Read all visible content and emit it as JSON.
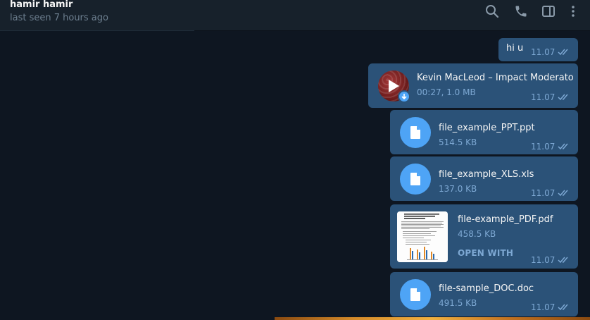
{
  "header": {
    "peer_name": "hamir hamir",
    "status": "last seen 7 hours ago",
    "icons": [
      "search-icon",
      "phone-icon",
      "sidebar-toggle-icon",
      "more-vertical-icon"
    ]
  },
  "messages": [
    {
      "kind": "text",
      "text": "hi u",
      "time": "11.07",
      "read": true
    },
    {
      "kind": "audio",
      "title": "Kevin MacLeod – Impact Moderato",
      "meta": "00:27, 1.0 MB",
      "time": "11.07",
      "read": true
    },
    {
      "kind": "file",
      "name": "file_example_PPT.ppt",
      "size": "514.5 KB",
      "time": "11.07",
      "read": true
    },
    {
      "kind": "file",
      "name": "file_example_XLS.xls",
      "size": "137.0 KB",
      "time": "11.07",
      "read": true
    },
    {
      "kind": "pdf",
      "name": "file-example_PDF.pdf",
      "size": "458.5 KB",
      "action": "OPEN WITH",
      "time": "11.07",
      "read": true
    },
    {
      "kind": "file",
      "name": "file-sample_DOC.doc",
      "size": "491.5 KB",
      "time": "11.07",
      "read": true
    }
  ],
  "colors": {
    "background": "#0e1621",
    "header": "#17212b",
    "bubble_out": "#2b5278",
    "accent": "#4ea4f6",
    "meta_text": "#7da8d3"
  }
}
